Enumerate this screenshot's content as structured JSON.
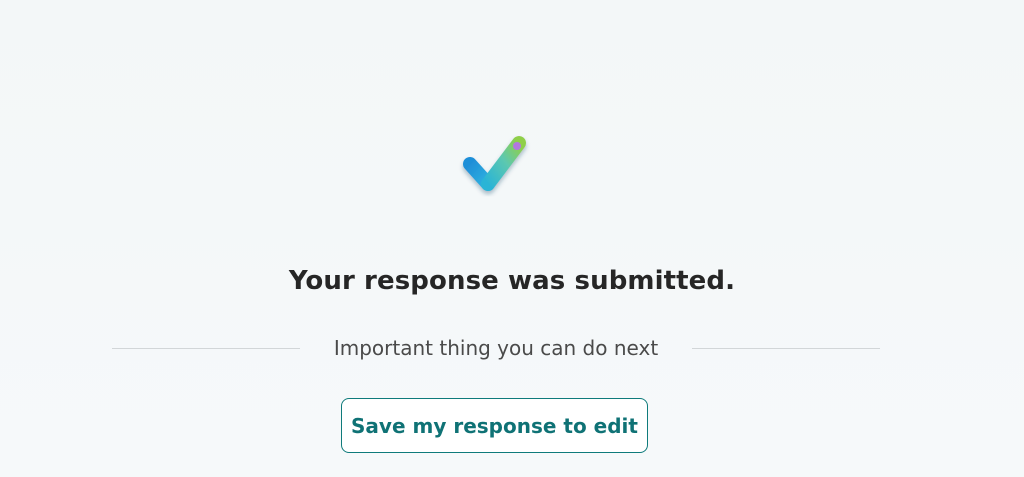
{
  "confirmation": {
    "icon": "checkmark-icon",
    "title": "Your response was submitted.",
    "divider_text": "Important thing you can do next",
    "save_button_label": "Save my response to edit"
  },
  "colors": {
    "background": "#f5f8f9",
    "title_text": "#262626",
    "button_border": "#0f7b7b",
    "button_text": "#0f7275",
    "divider_line": "#d2d6d8"
  }
}
